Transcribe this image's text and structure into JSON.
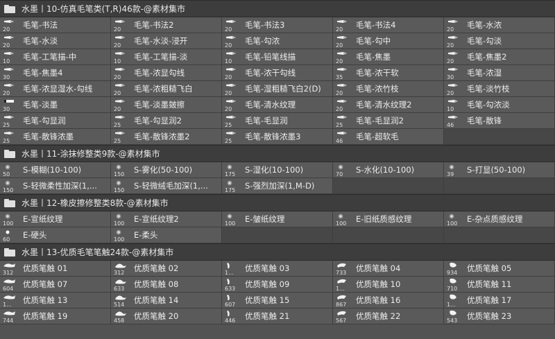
{
  "groups": [
    {
      "title": "水墨丨10-仿真毛笔类(T,R)46款-@素材集市",
      "columns": 5,
      "items": [
        {
          "name": "毛笔-书法",
          "size": "20",
          "icon": "pen-brush-icon"
        },
        {
          "name": "毛笔-书法2",
          "size": "20",
          "icon": "pen-brush-icon"
        },
        {
          "name": "毛笔-书法3",
          "size": "20",
          "icon": "pen-brush-icon"
        },
        {
          "name": "毛笔-书法4",
          "size": "20",
          "icon": "pen-brush-icon"
        },
        {
          "name": "毛笔-水浓",
          "size": "20",
          "icon": "pen-brush-icon"
        },
        {
          "name": "毛笔-水淡",
          "size": "20",
          "icon": "pen-brush-icon"
        },
        {
          "name": "毛笔-水淡-浸开",
          "size": "20",
          "icon": "pen-brush-icon"
        },
        {
          "name": "毛笔-勾浓",
          "size": "20",
          "icon": "pen-brush-icon"
        },
        {
          "name": "毛笔-勾中",
          "size": "20",
          "icon": "pen-brush-icon"
        },
        {
          "name": "毛笔-勾淡",
          "size": "20",
          "icon": "pen-brush-icon"
        },
        {
          "name": "毛笔-工笔描-中",
          "size": "10",
          "icon": "pen-brush-icon"
        },
        {
          "name": "毛笔-工笔描-淡",
          "size": "10",
          "icon": "pen-brush-icon"
        },
        {
          "name": "毛笔-铅笔线描",
          "size": "10",
          "icon": "pen-brush-icon"
        },
        {
          "name": "毛笔-焦墨",
          "size": "20",
          "icon": "pen-brush-icon"
        },
        {
          "name": "毛笔-焦墨2",
          "size": "20",
          "icon": "pen-brush-icon"
        },
        {
          "name": "毛笔-焦墨4",
          "size": "30",
          "icon": "pen-brush-icon"
        },
        {
          "name": "毛笔-浓显勾线",
          "size": "20",
          "icon": "pen-brush-icon"
        },
        {
          "name": "毛笔-浓干勾线",
          "size": "20",
          "icon": "pen-brush-icon"
        },
        {
          "name": "毛笔-浓干软",
          "size": "35",
          "icon": "pen-brush-icon"
        },
        {
          "name": "毛笔-浓湿",
          "size": "30",
          "icon": "pen-brush-icon"
        },
        {
          "name": "毛笔-浓显湿水-勾线",
          "size": "20",
          "icon": "pen-brush-icon"
        },
        {
          "name": "毛笔-浓粗糙飞白",
          "size": "20",
          "icon": "pen-brush-icon"
        },
        {
          "name": "毛笔-湿粗糙飞白2(D)",
          "size": "20",
          "icon": "pen-brush-icon"
        },
        {
          "name": "毛笔-浓竹枝",
          "size": "20",
          "icon": "pen-brush-icon"
        },
        {
          "name": "毛笔-淡竹枝",
          "size": "20",
          "icon": "pen-brush-icon"
        },
        {
          "name": "毛笔-淡墨",
          "size": "30",
          "icon": "flat-brush-icon"
        },
        {
          "name": "毛笔-淡墨皴擦",
          "size": "20",
          "icon": "pen-brush-icon"
        },
        {
          "name": "毛笔-清水纹理",
          "size": "20",
          "icon": "pen-brush-icon"
        },
        {
          "name": "毛笔-清水纹理2",
          "size": "20",
          "icon": "pen-brush-icon"
        },
        {
          "name": "毛笔-勾浓淡",
          "size": "10",
          "icon": "pen-brush-icon"
        },
        {
          "name": "毛笔-勾显润",
          "size": "25",
          "icon": "pen-brush-icon"
        },
        {
          "name": "毛笔-勾显润2",
          "size": "25",
          "icon": "pen-brush-icon"
        },
        {
          "name": "毛笔-毛显润",
          "size": "25",
          "icon": "pen-brush-icon"
        },
        {
          "name": "毛笔-毛显润2",
          "size": "25",
          "icon": "pen-brush-icon"
        },
        {
          "name": "毛笔-散锋",
          "size": "46",
          "icon": "pen-brush-icon"
        },
        {
          "name": "毛笔-散锋浓墨",
          "size": "25",
          "icon": "pen-brush-icon"
        },
        {
          "name": "毛笔-散锋浓墨2",
          "size": "25",
          "icon": "pen-brush-icon"
        },
        {
          "name": "毛笔-散锋浓墨3",
          "size": "25",
          "icon": "pen-brush-icon"
        },
        {
          "name": "毛笔-超软毛",
          "size": "46",
          "icon": "pen-brush-icon"
        }
      ]
    },
    {
      "title": "水墨丨11-涂抹修整类9款-@素材集市",
      "columns": 5,
      "items": [
        {
          "name": "S-模糊(10-100)",
          "size": "50",
          "icon": "soft-round-icon"
        },
        {
          "name": "S-雾化(50-100)",
          "size": "150",
          "icon": "soft-round-icon"
        },
        {
          "name": "S-湿化(10-100)",
          "size": "175",
          "icon": "soft-round-icon"
        },
        {
          "name": "S-水化(10-100)",
          "size": "70",
          "icon": "soft-round-icon"
        },
        {
          "name": "S-打显(50-100)",
          "size": "39",
          "icon": "soft-round-icon"
        },
        {
          "name": "S-轻微柔性加深(1,...",
          "size": "150",
          "icon": "soft-round-icon"
        },
        {
          "name": "S-轻微绒毛加深(1,...",
          "size": "150",
          "icon": "soft-round-icon"
        },
        {
          "name": "S-强烈加深(1,M-D)",
          "size": "175",
          "icon": "soft-round-icon"
        }
      ]
    },
    {
      "title": "水墨丨12-橡皮擦修整类8款-@素材集市",
      "columns": 5,
      "items": [
        {
          "name": "E-宣纸纹理",
          "size": "100",
          "icon": "soft-round-icon"
        },
        {
          "name": "E-宣纸纹理2",
          "size": "100",
          "icon": "soft-round-icon"
        },
        {
          "name": "E-皱纸纹理",
          "size": "100",
          "icon": "soft-round-icon"
        },
        {
          "name": "E-旧纸质感纹理",
          "size": "100",
          "icon": "soft-round-icon"
        },
        {
          "name": "E-杂点质感纹理",
          "size": "100",
          "icon": "soft-round-icon"
        },
        {
          "name": "E-硬头",
          "size": "60",
          "icon": "hard-round-icon"
        },
        {
          "name": "E-柔头",
          "size": "100",
          "icon": "soft-round-icon"
        }
      ]
    },
    {
      "title": "水墨丨13-优质毛笔笔触24款-@素材集市",
      "columns": 5,
      "items": [
        {
          "name": "优质笔触 01",
          "size": "312",
          "icon": "stroke-shape-icon"
        },
        {
          "name": "优质笔触 02",
          "size": "312",
          "icon": "stroke-shape-icon"
        },
        {
          "name": "优质笔触 03",
          "size": "1...",
          "icon": "stroke-shape-icon"
        },
        {
          "name": "优质笔触 04",
          "size": "733",
          "icon": "stroke-shape-icon"
        },
        {
          "name": "优质笔触 05",
          "size": "934",
          "icon": "stroke-shape-icon"
        },
        {
          "name": "优质笔触 07",
          "size": "604",
          "icon": "stroke-shape-icon"
        },
        {
          "name": "优质笔触 08",
          "size": "633",
          "icon": "stroke-shape-icon"
        },
        {
          "name": "优质笔触 09",
          "size": "633",
          "icon": "stroke-shape-icon"
        },
        {
          "name": "优质笔触 10",
          "size": "1...",
          "icon": "stroke-shape-icon"
        },
        {
          "name": "优质笔触 11",
          "size": "710",
          "icon": "stroke-shape-icon"
        },
        {
          "name": "优质笔触 13",
          "size": "1...",
          "icon": "stroke-shape-icon"
        },
        {
          "name": "优质笔触 14",
          "size": "514",
          "icon": "stroke-shape-icon"
        },
        {
          "name": "优质笔触 15",
          "size": "607",
          "icon": "stroke-shape-icon"
        },
        {
          "name": "优质笔触 16",
          "size": "867",
          "icon": "stroke-shape-icon"
        },
        {
          "name": "优质笔触 17",
          "size": "1...",
          "icon": "stroke-shape-icon"
        },
        {
          "name": "优质笔触 19",
          "size": "744",
          "icon": "stroke-shape-icon"
        },
        {
          "name": "优质笔触 20",
          "size": "458",
          "icon": "stroke-shape-icon"
        },
        {
          "name": "优质笔触 21",
          "size": "446",
          "icon": "stroke-shape-icon"
        },
        {
          "name": "优质笔触 22",
          "size": "567",
          "icon": "stroke-shape-icon"
        },
        {
          "name": "优质笔触 23",
          "size": "543",
          "icon": "stroke-shape-icon"
        }
      ]
    }
  ]
}
